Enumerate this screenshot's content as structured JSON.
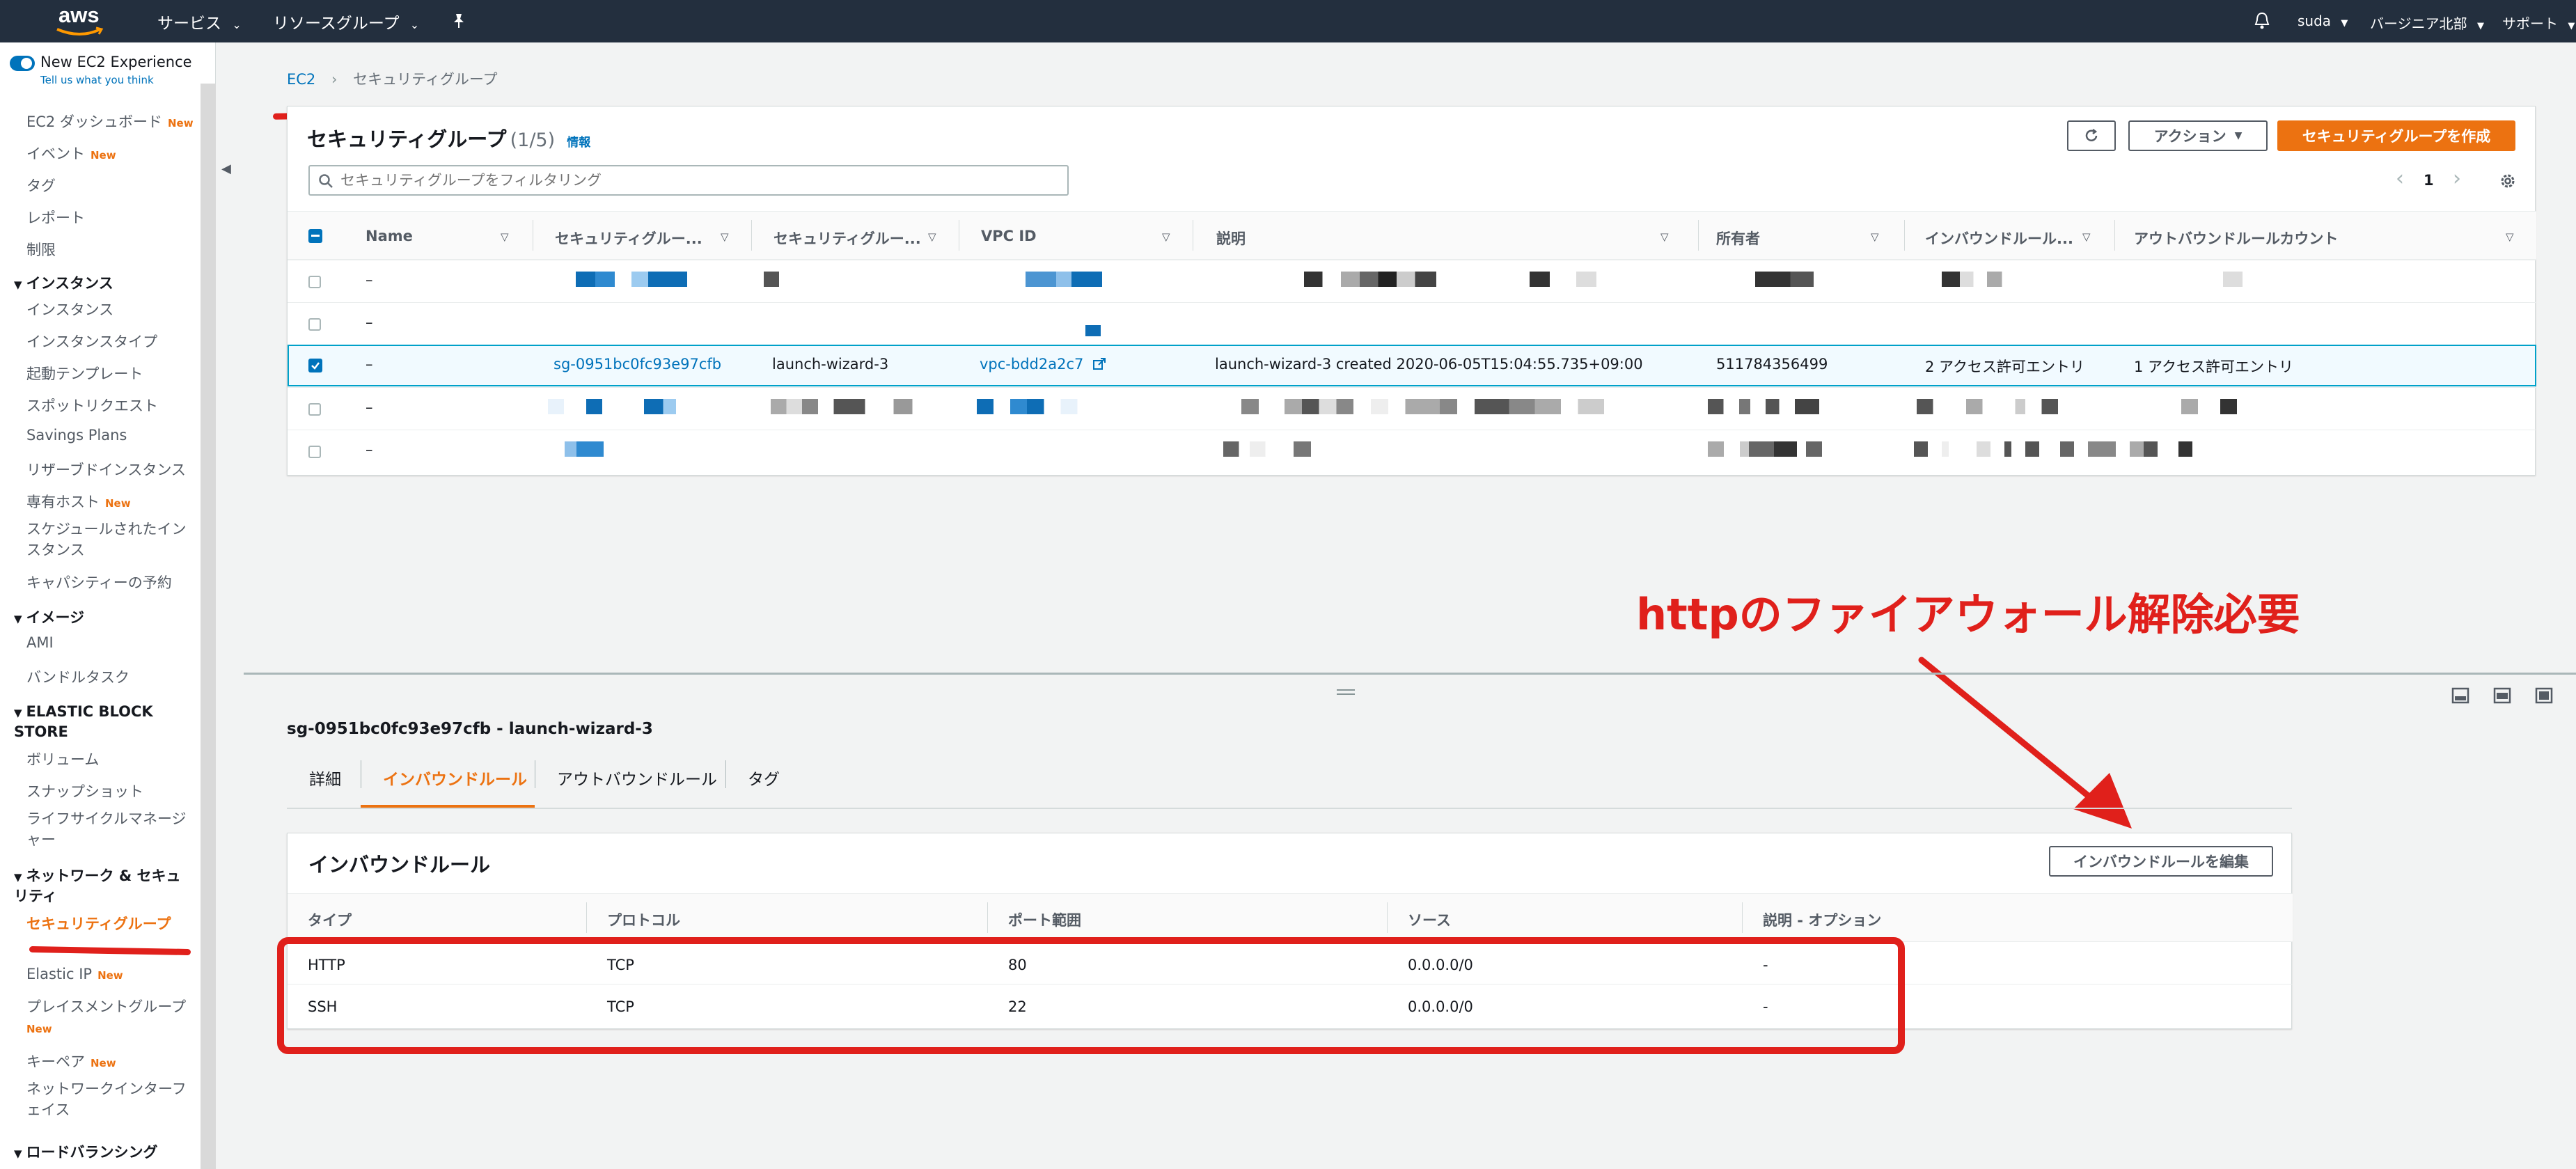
{
  "topnav": {
    "logo": "aws",
    "services": "サービス",
    "resource_groups": "リソースグループ",
    "user": "suda",
    "region": "バージニア北部",
    "support": "サポート"
  },
  "sidebar": {
    "toggle_label": "New EC2 Experience",
    "toggle_sub": "Tell us what you think",
    "new_tag": "New",
    "items": {
      "dashboard": "EC2 ダッシュボード",
      "events": "イベント",
      "tags": "タグ",
      "reports": "レポート",
      "limits": "制限",
      "instances_header": "インスタンス",
      "instances": "インスタンス",
      "instance_types": "インスタンスタイプ",
      "launch_templates": "起動テンプレート",
      "spot_requests": "スポットリクエスト",
      "savings_plans": "Savings Plans",
      "reserved": "リザーブドインスタンス",
      "dedicated_hosts": "専有ホスト",
      "scheduled": "スケジュールされたインスタンス",
      "capacity": "キャパシティーの予約",
      "images_header": "イメージ",
      "ami": "AMI",
      "bundle_tasks": "バンドルタスク",
      "ebs_header": "ELASTIC BLOCK STORE",
      "volumes": "ボリューム",
      "snapshots": "スナップショット",
      "lifecycle": "ライフサイクルマネージャー",
      "network_header": "ネットワーク & セキュリティ",
      "security_groups": "セキュリティグループ",
      "elastic_ip": "Elastic IP",
      "placement_groups": "プレイスメントグループ",
      "key_pairs": "キーペア",
      "network_interfaces": "ネットワークインターフェイス",
      "lb_header": "ロードバランシング"
    }
  },
  "breadcrumb": {
    "root": "EC2",
    "current": "セキュリティグループ"
  },
  "sg_panel": {
    "title": "セキュリティグループ",
    "count": "(1/5)",
    "info": "情報",
    "actions_label": "アクション",
    "create_label": "セキュリティグループを作成",
    "filter_placeholder": "セキュリティグループをフィルタリング",
    "page_number": "1",
    "columns": [
      "Name",
      "セキュリティグルー...",
      "セキュリティグルー...",
      "VPC ID",
      "説明",
      "所有者",
      "インバウンドルール...",
      "アウトバウンドルールカウント"
    ],
    "rows": [
      {
        "name": "–"
      },
      {
        "name": "–"
      },
      {
        "name": "–",
        "group_id": "sg-0951bc0fc93e97cfb",
        "group_name": "launch-wizard-3",
        "vpc_id": "vpc-bdd2a2c7",
        "description": "launch-wizard-3 created 2020-06-05T15:04:55.735+09:00",
        "owner": "511784356499",
        "inbound": "2 アクセス許可エントリ",
        "outbound": "1 アクセス許可エントリ"
      },
      {
        "name": "–"
      },
      {
        "name": "–"
      }
    ]
  },
  "annotation": {
    "text": "httpのファイアウォール解除必要",
    "color": "#e0201b"
  },
  "detail": {
    "title": "sg-0951bc0fc93e97cfb - launch-wizard-3",
    "tabs": [
      "詳細",
      "インバウンドルール",
      "アウトバウンドルール",
      "タグ"
    ],
    "active_tab": "インバウンドルール"
  },
  "rules_panel": {
    "title": "インバウンドルール",
    "edit_label": "インバウンドルールを編集",
    "columns": [
      "タイプ",
      "プロトコル",
      "ポート範囲",
      "ソース",
      "説明 - オプション"
    ],
    "rows": [
      {
        "type": "HTTP",
        "protocol": "TCP",
        "port": "80",
        "source": "0.0.0.0/0",
        "description": "-"
      },
      {
        "type": "SSH",
        "protocol": "TCP",
        "port": "22",
        "source": "0.0.0.0/0",
        "description": "-"
      }
    ]
  },
  "colors": {
    "nav_bg": "#232f3e",
    "accent_orange": "#ec7211",
    "link_blue": "#0073bb",
    "selected_row": "#f1faff",
    "selected_border": "#00a1c9"
  }
}
